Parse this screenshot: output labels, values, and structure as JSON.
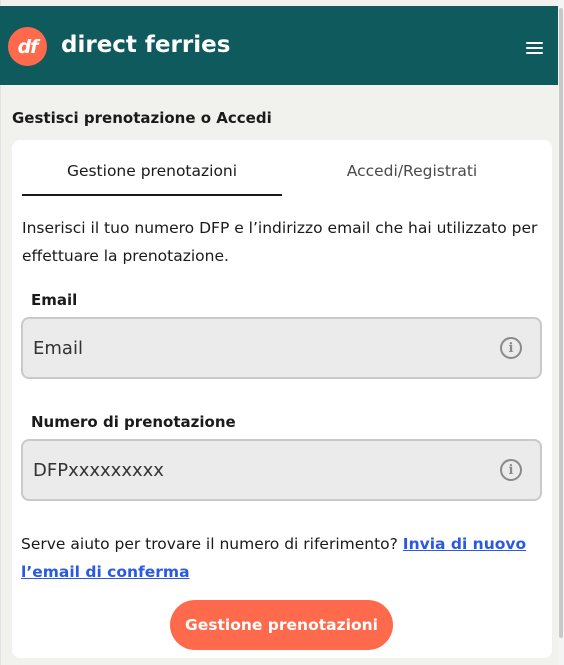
{
  "header": {
    "logo_text": "df",
    "brand_name": "direct ferries",
    "menu_icon": "hamburger-menu-icon"
  },
  "page": {
    "title": "Gestisci prenotazione o Accedi"
  },
  "tabs": [
    {
      "label": "Gestione prenotazioni",
      "active": true
    },
    {
      "label": "Accedi/Registrati",
      "active": false
    }
  ],
  "form": {
    "intro": "Inserisci il tuo numero DFP e l’indirizzo email che hai utilizzato per effettuare la prenotazione.",
    "email": {
      "label": "Email",
      "placeholder": "Email",
      "value": "",
      "icon": "info-icon"
    },
    "booking": {
      "label": "Numero di prenotazione",
      "placeholder": "DFPxxxxxxxxx",
      "value": "",
      "icon": "info-icon"
    },
    "help_text": "Serve aiuto per trovare il numero di riferimento? ",
    "help_link": "Invia di nuovo l’email di conferma",
    "submit_label": "Gestione prenotazioni"
  },
  "colors": {
    "header_bg": "#0f5a5c",
    "accent": "#ff6a4d",
    "link": "#2a5adf"
  }
}
